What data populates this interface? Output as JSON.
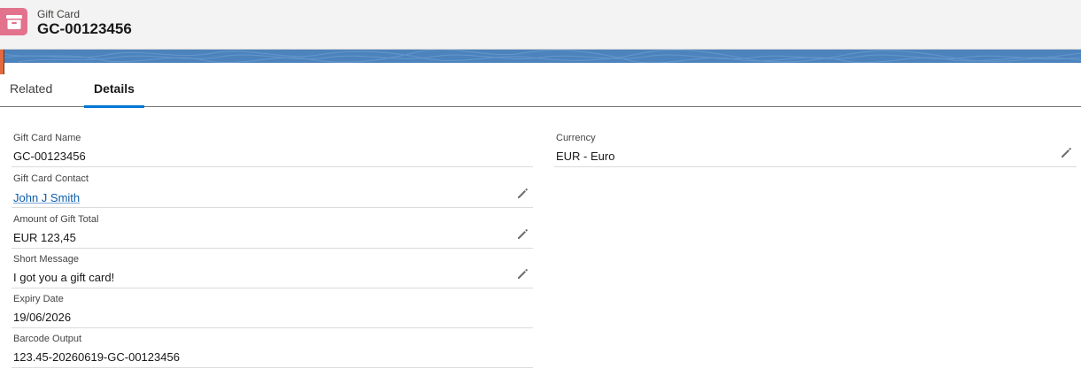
{
  "header": {
    "object_label": "Gift Card",
    "record_title": "GC-00123456",
    "icon": "gift-card-box-icon",
    "icon_color": "#e3728c",
    "banner_color": "#4c83bd"
  },
  "tabs": [
    {
      "label": "Related",
      "active": false
    },
    {
      "label": "Details",
      "active": true
    }
  ],
  "left_fields": [
    {
      "label": "Gift Card Name",
      "value": "GC-00123456",
      "editable": false,
      "link": false
    },
    {
      "label": "Gift Card Contact",
      "value": "John J Smith",
      "editable": true,
      "link": true
    },
    {
      "label": "Amount of Gift Total",
      "value": "EUR 123,45",
      "editable": true,
      "link": false
    },
    {
      "label": "Short Message",
      "value": "I got you a gift card!",
      "editable": true,
      "link": false
    },
    {
      "label": "Expiry Date",
      "value": "19/06/2026",
      "editable": false,
      "link": false
    },
    {
      "label": "Barcode Output",
      "value": "123.45-20260619-GC-00123456",
      "editable": false,
      "link": false
    }
  ],
  "right_fields": [
    {
      "label": "Currency",
      "value": "EUR - Euro",
      "editable": true,
      "link": false
    }
  ],
  "accent_color": "#0176d3",
  "edit_icon": "pencil-icon"
}
